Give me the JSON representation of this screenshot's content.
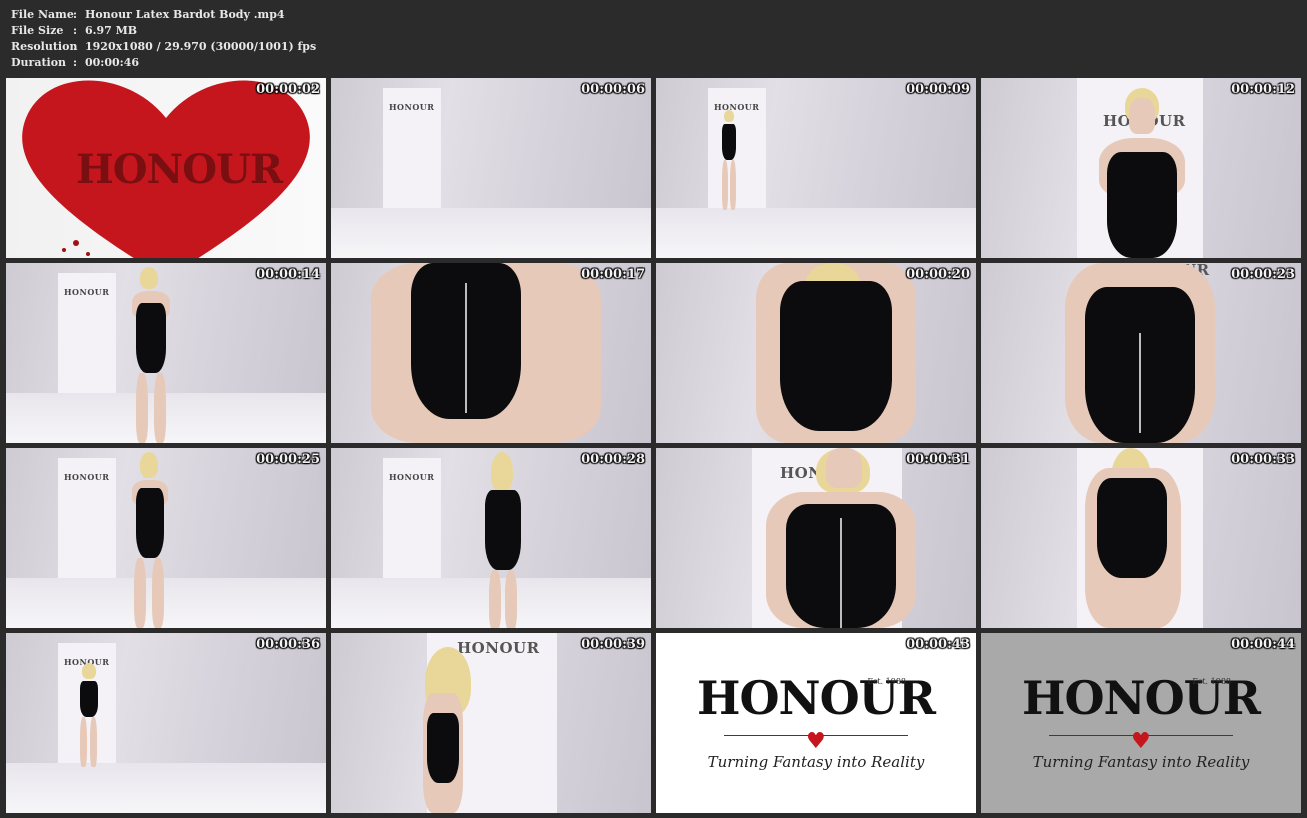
{
  "header": {
    "file_name_label": "File Name",
    "file_name_value": "Honour Latex Bardot Body .mp4",
    "file_size_label": "File Size",
    "file_size_value": "6.97 MB",
    "resolution_label": "Resolution",
    "resolution_value": "1920x1080 / 29.970 (30000/1001) fps",
    "duration_label": "Duration",
    "duration_value": "00:00:46",
    "separator": ":"
  },
  "brand": {
    "name": "HONOUR",
    "est": "Est. 1988",
    "tagline": "Turning Fantasy into Reality"
  },
  "thumbnails": [
    {
      "time": "00:00:02"
    },
    {
      "time": "00:00:06"
    },
    {
      "time": "00:00:09"
    },
    {
      "time": "00:00:12"
    },
    {
      "time": "00:00:14"
    },
    {
      "time": "00:00:17"
    },
    {
      "time": "00:00:20"
    },
    {
      "time": "00:00:23"
    },
    {
      "time": "00:00:25"
    },
    {
      "time": "00:00:28"
    },
    {
      "time": "00:00:31"
    },
    {
      "time": "00:00:33"
    },
    {
      "time": "00:00:36"
    },
    {
      "time": "00:00:39"
    },
    {
      "time": "00:00:43"
    },
    {
      "time": "00:00:44"
    }
  ],
  "colors": {
    "background": "#2b2b2b",
    "heart_red": "#c4161c",
    "latex_black": "#0c0c0e"
  }
}
